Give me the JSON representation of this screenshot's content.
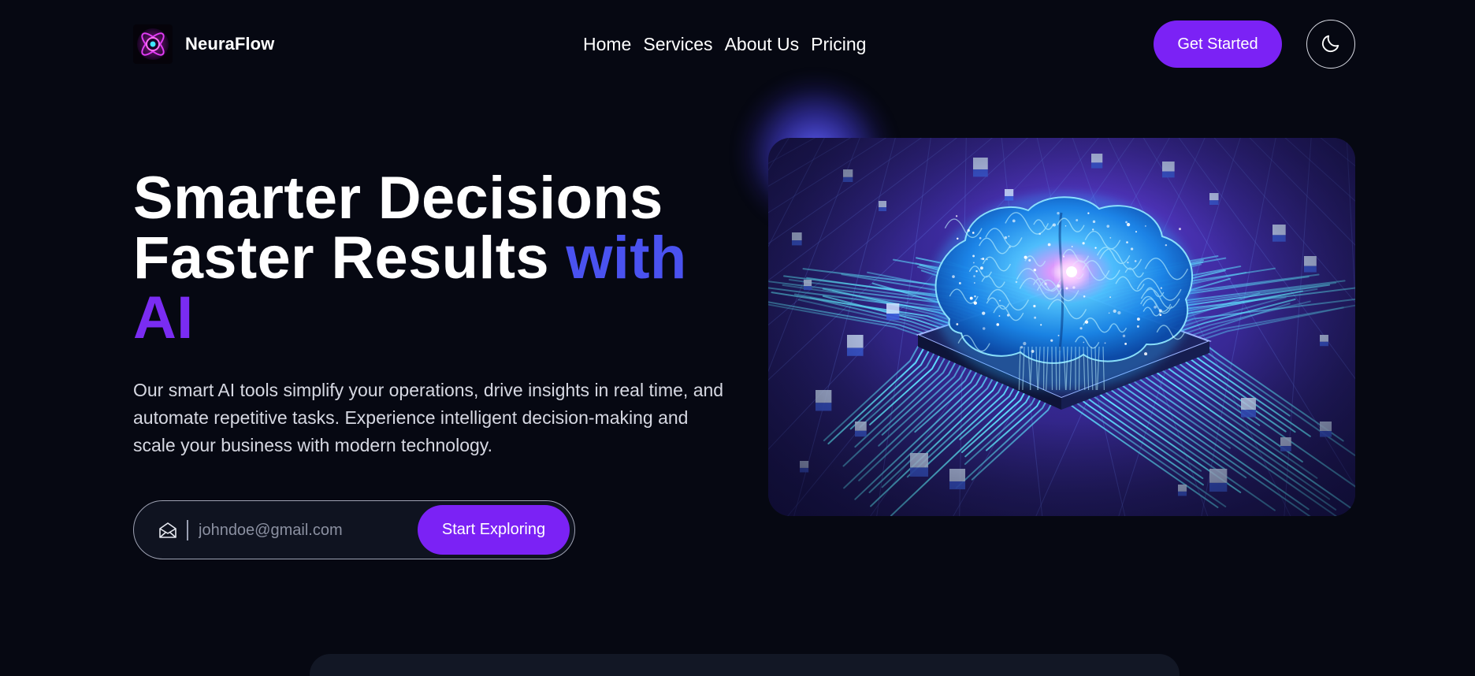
{
  "brand": {
    "name": "NeuraFlow"
  },
  "nav": {
    "links": [
      {
        "label": "Home"
      },
      {
        "label": "Services"
      },
      {
        "label": "About Us"
      },
      {
        "label": "Pricing"
      }
    ],
    "cta_label": "Get Started",
    "theme_icon": "moon-icon"
  },
  "hero": {
    "title_line1": "Smarter Decisions",
    "title_line2": "Faster Results",
    "title_accent1": "with",
    "title_accent2": "AI",
    "description": "Our smart AI tools simplify your operations, drive insights in real time, and automate repetitive tasks. Experience intelligent decision-making and scale your business with modern technology.",
    "email_placeholder": "johndoe@gmail.com",
    "email_icon": "mail-icon",
    "explore_label": "Start Exploring",
    "image_icon": "ai-brain-circuit-image"
  },
  "colors": {
    "background": "#060812",
    "accent_purple": "#7b22f5",
    "accent_blue": "#4a52f0"
  }
}
